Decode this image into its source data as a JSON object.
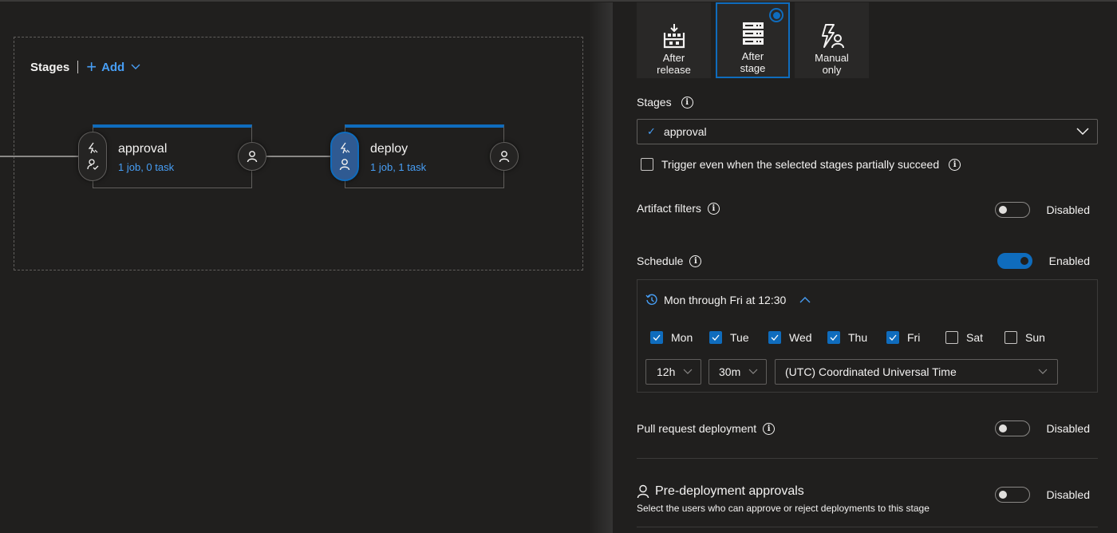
{
  "canvas": {
    "stages_title": "Stages",
    "add_label": "Add",
    "stages": [
      {
        "name": "approval",
        "summary": "1 job, 0 task",
        "pre_active": false
      },
      {
        "name": "deploy",
        "summary": "1 job, 1 task",
        "pre_active": true
      }
    ]
  },
  "panel": {
    "trigger_options": [
      {
        "label_line1": "After",
        "label_line2": "release",
        "icon": "release-icon",
        "selected": false
      },
      {
        "label_line1": "After",
        "label_line2": "stage",
        "icon": "server-stack-icon",
        "selected": true
      },
      {
        "label_line1": "Manual",
        "label_line2": "only",
        "icon": "manual-trigger-icon",
        "selected": false
      }
    ],
    "stages_label": "Stages",
    "stages_selected": "approval",
    "partial_succeed_label": "Trigger even when the selected stages partially succeed",
    "partial_succeed_checked": false,
    "artifact_filters": {
      "label": "Artifact filters",
      "state": "Disabled",
      "enabled": false
    },
    "schedule": {
      "label": "Schedule",
      "state": "Enabled",
      "enabled": true,
      "summary": "Mon through Fri at 12:30",
      "days": [
        {
          "label": "Mon",
          "checked": true
        },
        {
          "label": "Tue",
          "checked": true
        },
        {
          "label": "Wed",
          "checked": true
        },
        {
          "label": "Thu",
          "checked": true
        },
        {
          "label": "Fri",
          "checked": true
        },
        {
          "label": "Sat",
          "checked": false
        },
        {
          "label": "Sun",
          "checked": false
        }
      ],
      "hour": "12h",
      "minute": "30m",
      "timezone": "(UTC) Coordinated Universal Time"
    },
    "pull_request": {
      "label": "Pull request deployment",
      "state": "Disabled",
      "enabled": false
    },
    "pre_approvals": {
      "title": "Pre-deployment approvals",
      "description": "Select the users who can approve or reject deployments to this stage",
      "state": "Disabled",
      "enabled": false
    }
  },
  "colors": {
    "accent": "#0f6cbd",
    "link": "#479ef5",
    "background": "#201f1e"
  }
}
